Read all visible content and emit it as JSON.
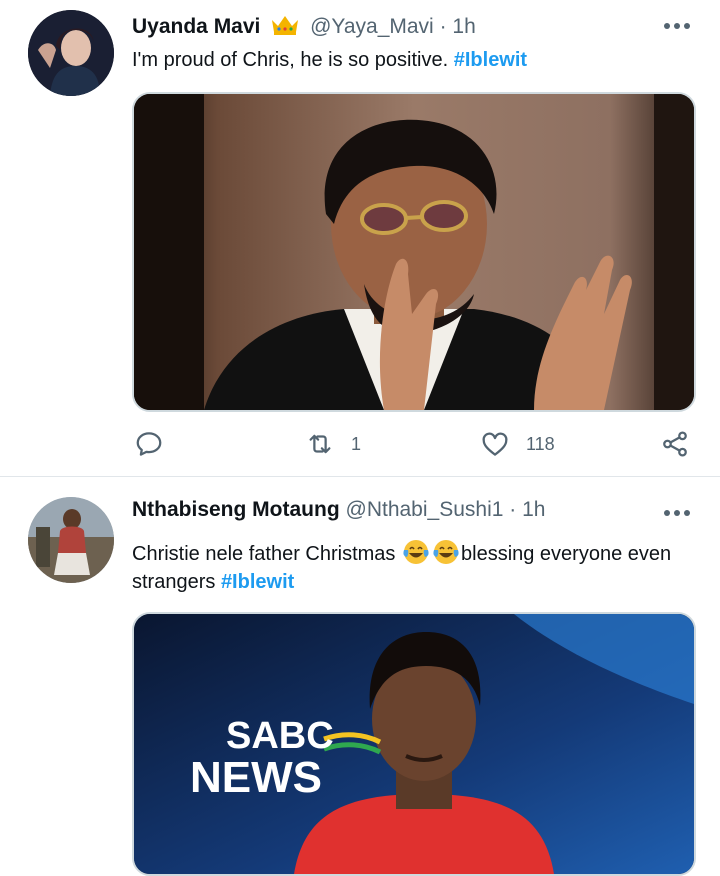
{
  "tweets": [
    {
      "name": "Uyanda Mavi",
      "handle": "@Yaya_Mavi",
      "separator": "·",
      "time": "1h",
      "text": "I'm proud of Chris, he is so positive.",
      "hashtag": "#Iblewit",
      "media_alt": "man in gold sunglasses clapping",
      "reply_count": "",
      "retweet_count": "1",
      "like_count": "118"
    },
    {
      "name": "Nthabiseng Motaung",
      "handle": "@Nthabi_Sushi1",
      "separator": "·",
      "time": "1h",
      "text_before": "Christie nele father Christmas",
      "text_after": "blessing everyone even strangers",
      "hashtag": "#Iblewit",
      "media_logo_line1": "SABC",
      "media_logo_line2": "NEWS"
    }
  ],
  "colors": {
    "accent": "#1d9bf0",
    "secondary_text": "#536471"
  }
}
